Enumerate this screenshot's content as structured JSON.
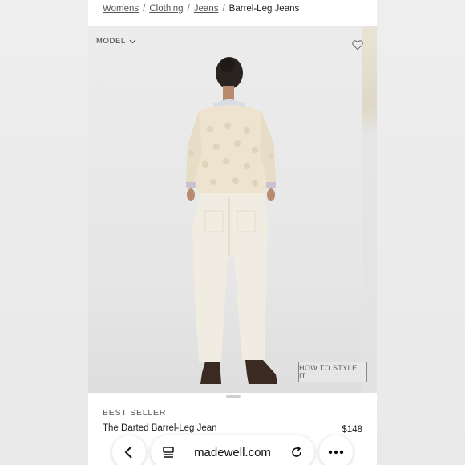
{
  "breadcrumb": {
    "items": [
      "Womens",
      "Clothing",
      "Jeans"
    ],
    "separator": "/",
    "current": "Barrel-Leg Jeans"
  },
  "image": {
    "model_label": "MODEL",
    "style_button": "HOW TO STYLE IT",
    "icons": {
      "model_dropdown": "chevron-down-icon",
      "favorite": "heart-icon"
    }
  },
  "product": {
    "badge": "BEST SELLER",
    "name": "The Darted Barrel-Leg Jean",
    "price": "$148"
  },
  "browser": {
    "url": "madewell.com",
    "icons": [
      "back-arrow-icon",
      "tab-menu-icon",
      "reload-icon",
      "more-options-icon"
    ]
  },
  "colors": {
    "background": "#efefef",
    "image_bg": "#e8e8e8",
    "sweater": "#ede3cf",
    "jeans": "#f1ece2",
    "boots": "#3a2a22"
  }
}
